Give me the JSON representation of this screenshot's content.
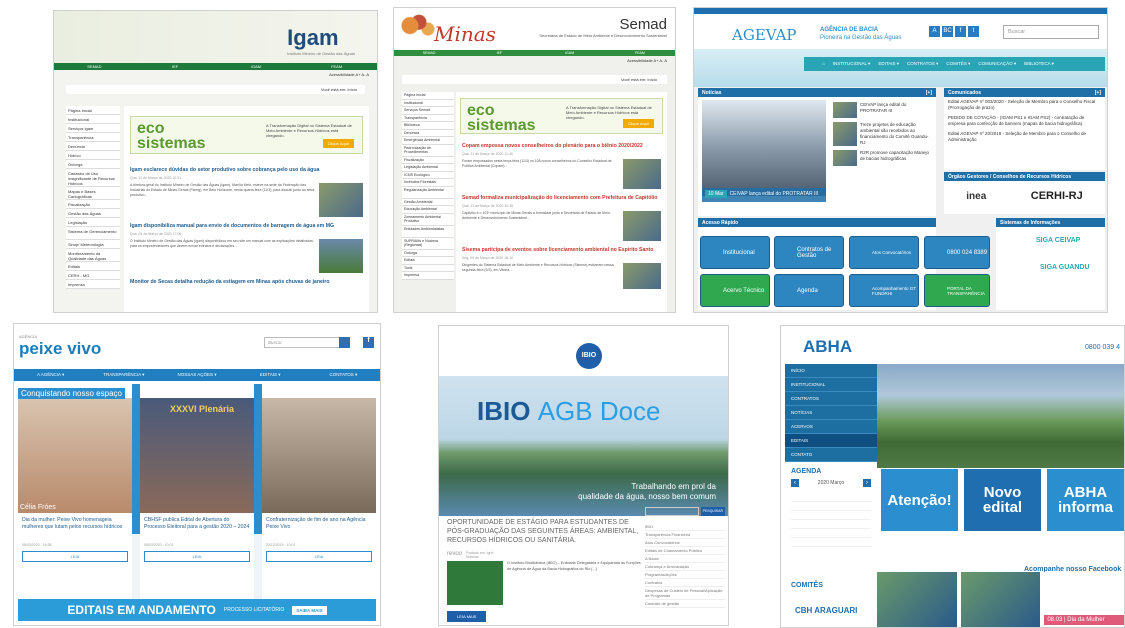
{
  "p1": {
    "logo": "Igam",
    "logo_sub": "Instituto Mineiro de Gestão das Águas",
    "nav": [
      "SEMAD",
      "IEF",
      "IGAM",
      "FEAM"
    ],
    "acc": "Acessibilidade  A+  A-  A",
    "path": "Você está em: Início",
    "side": [
      "Página Inicial",
      "Institucional",
      "Serviços Igam",
      "Transparência",
      "Denúncia",
      "Hídrico",
      "Outorga",
      "Cadastro de Uso Insignificante de Recursos Hídricos",
      "Mapas e Bases Cartográficas",
      "Fiscalização",
      "Gestão das Águas",
      "Legislação",
      "Sistema de Gerenciamento",
      "Sinop/ Meteorologia",
      "Monitoramento da Qualidade das Águas",
      "Editais",
      "CERH - MG",
      "Imprensa"
    ],
    "eco": {
      "w1": "eco",
      "w2": "sistemas",
      "d": "A Transformação Digital no Sistema Estadual de Meio Ambiente e Recursos Hídricos está chegando.",
      "btn": "Clique Aqui!"
    },
    "news": [
      {
        "h": "Igam esclarece dúvidas do setor produtivo sobre cobrança pelo uso da água",
        "d": "Qua, 11 de Março de 2020 10:31",
        "b": "A diretora-geral do Instituto Mineiro de Gestão das Águas (Igam), Marília Melo, esteve na sede da Federação das Indústrias do Estado de Minas Gerais (Fiemg), em Belo Horizonte, nesta quarta-feira (11/3), para discutir junto ao setor produtivo..."
      },
      {
        "h": "Igam disponibiliza manual para envio de documentos de barragem de água em MG",
        "d": "Qua, 04 de Março de 2020 17:06",
        "b": "O Instituto Mineiro de Gestão das Águas (Igam) disponibilizou em seu site um manual com as explicações detalhadas para os empreendedores que devem enviar extratos e declarações..."
      },
      {
        "h": "Monitor de Secas detalha redução da estiagem em Minas após chuvas de janeiro",
        "d": "",
        "b": ""
      }
    ]
  },
  "p2": {
    "minas": "Minas",
    "title": "Semad",
    "sub": "Secretaria de Estado de Meio Ambiente e Desenvolvimento Sustentável",
    "nav": [
      "SEMAD",
      "IEF",
      "IGAM",
      "FEAM"
    ],
    "acc": "Acessibilidade  A+  A-  A",
    "path": "Você está em: Início",
    "side": [
      "Página Inicial",
      "Institucional",
      "Serviços Semad",
      "Transparência",
      "Biblioteca",
      "Denúncia",
      "Emergência Ambiental",
      "Padronização de Procedimentos",
      "Fiscalização",
      "Legislação Ambiental",
      "ICMS Ecológico",
      "Incêndios Florestais",
      "Regularização Ambiental",
      "Gestão Ambiental",
      "Educação Ambiental",
      "Zoneamento Ambiental Produtivo",
      "Entidades Ambientalistas",
      "SUPRAMs e Núcleos (Regionais)",
      "Outorga",
      "Editais",
      "Tools",
      "Imprensa"
    ],
    "eco": {
      "w1": "eco",
      "w2": "sistemas",
      "d": "A Transformação Digital no Sistema Estadual de Meio Ambiente e Recursos Hídricos está chegando.",
      "btn": "Clique Aqui!"
    },
    "news": [
      {
        "h": "Copam empossa novos conselheiros do plenário para o biênio 2020/2022",
        "d": "Qua, 11 de Março de 2020 11:40",
        "b": "Foram empossados nesta terça-feira (11/3) os 108 novos conselheiros do Conselho Estadual de Política Ambiental (Copam)..."
      },
      {
        "h": "Semad formaliza municipalização do licenciamento com Prefeitura de Capitólio",
        "d": "Qua, 11 de Março de 2020 10:36",
        "b": "Capitólio é o 103º município de Minas Gerais a formalizar junto à Secretaria de Estado de Meio Ambiente e Desenvolvimento Sustentável..."
      },
      {
        "h": "Sisema participa de eventos sobre licenciamento ambiental no Espírito Santo",
        "d": "Seg, 09 de Março de 2020 18:10",
        "b": "Dirigentes do Sistema Estadual de Meio Ambiente e Recursos Hídricos (Sisema) estiveram nessa segunda-feira (9/3), em Vitória..."
      }
    ]
  },
  "p3": {
    "logo": "AGEVAP",
    "t1": "AGÊNCIA DE BACIA",
    "t2": "Pioneira na Gestão das Águas",
    "social": [
      "A",
      "BC",
      "f",
      "t"
    ],
    "search": "Buscar",
    "nav": [
      "INSTITUCIONAL ▾",
      "EDITAIS ▾",
      "CONTRATOS ▾",
      "COMITÊS ▾",
      "COMUNICAÇÃO ▾",
      "BIBLIOTECA ▾"
    ],
    "noticias": {
      "h": "Notícias",
      "plus": "[+]",
      "items": [
        "CEIVAP lança edital do PROTRATAR III",
        "Treze projetos de educação ambiental são recebidos ao financiamento do Comitê Guandu-RJ",
        "R2R promove capacitação Manejo de bacias hidrográficas"
      ],
      "date": "10 Mar",
      "cap": "CEIVAP lança edital do PROTRATAR III"
    },
    "comunicados": {
      "h": "Comunicados",
      "plus": "[+]",
      "items": [
        "Edital AGEVAP nº 003/2020 - Seleção de Membro para o Conselho Fiscal (Prorrogação de prazo)",
        "PEDIDO DE COTAÇÃO - (IGAM PS1 e IGAM PS2) - contratação de empresa para confecção de banners (mapas de bacia hidrográfica).",
        "Edital AGEVAP nº 20/2019 - Seleção de Membro para o Conselho de Administração"
      ]
    },
    "orgaos": {
      "h": "Órgãos Gestores / Conselhos de Recursos Hídricos",
      "a": "inea",
      "b": "CERHI-RJ"
    },
    "acesso": {
      "h": "Acesso Rápido",
      "btns": [
        "Institucional",
        "Contratos de Gestão",
        "Atos Convocatórios",
        "0800 024 8389",
        "Acervo Técnico",
        "Agenda",
        "Acompanhamento GT FUNDRHI",
        "PORTAL DA TRANSPARÊNCIA"
      ]
    },
    "sistemas": {
      "h": "Sistemas de Informações",
      "a": "SIGA CEIVAP",
      "b": "SIGA GUANDU"
    }
  },
  "p4": {
    "logo": "peixe vivo",
    "logo_sub": "AGÊNCIA",
    "search": "Buscar",
    "fb": "f",
    "nav": [
      "A AGÊNCIA ▾",
      "TRANSPARÊNCIA ▾",
      "NOSSAS AÇÕES ▾",
      "EDITAIS ▾",
      "CONTATOS ▾"
    ],
    "banner": "Conquistando nosso espaço",
    "cards": [
      {
        "cap": "Célia Fróes",
        "t": "Dia da mulher: Peixe Vivo homenageia mulheres que lutam pelos recursos hídricos",
        "d": "08/03/2020 - 16:38",
        "b": "LEIA"
      },
      {
        "cap": "XXXVI Plenária",
        "t": "CBHSF publica Edital de Abertura do Processo Eleitoral para a gestão 2020 – 2024",
        "d": "05/03/2020 - 10:01",
        "b": "LEIA"
      },
      {
        "cap": "",
        "t": "Confraternização de fim de ano na Agência Peixe Vivo",
        "d": "20/12/2019 - 10:01",
        "b": "LEIA"
      }
    ],
    "editais": "EDITAIS EM ANDAMENTO",
    "proc": "PROCESSO LICITATÓRIO",
    "saiba": "SAIBA MAIS"
  },
  "p5": {
    "logo": "IBIO",
    "t1": "IBIO",
    "t2": "AGB Doce",
    "sub1": "Trabalhando em prol da",
    "sub2": "qualidade da água, nosso bem comum",
    "op": "OPORTUNIDADE DE ESTÁGIO PARA ESTUDANTES DE PÓS-GRADUAÇÃO DAS SEGUINTES ÁREAS: AMBIENTAL, RECURSOS HÍDRICOS OU SANITÁRIA.",
    "rev": "revoo",
    "post": "Postado em: Igrol Notícias",
    "body": "O Instituto BioAtlântica (IBIO) – Entidade Delegatária e Equiparada às Funções de Agência de Água da Bacia Hidrográfica do Rio [...]",
    "leia": "LEIA MAIS",
    "pesq": "PESQUISAR",
    "links": [
      "IBIO",
      "Transparência Financeira",
      "Atos Convocatórios",
      "Editais de Chamamento Público",
      "A Bacia",
      "Cobrança e Arrecadação",
      "Programas/Ações",
      "Contratos",
      "Despesas de Custeio de Pessoal/Aplicação de Programas",
      "Contrato de gestão"
    ]
  },
  "p6": {
    "logo": "ABHA",
    "phone": "0800 039 4",
    "menu": [
      "INÍCIO",
      "INSTITUCIONAL",
      "CONTRATOS",
      "NOTÍCIAS",
      "ACERVOS",
      "EDITAIS",
      "CONTATO"
    ],
    "agenda": "AGENDA",
    "month": "2020 Março",
    "tiles": [
      "Atenção!",
      "Novo edital",
      "ABHA informa"
    ],
    "comites": "COMITÊS",
    "arag": "CBH ARAGUARI",
    "fb": "Acompanhe nosso Facebook",
    "last": "08.03 | Dia da Mulher"
  },
  "colors": {
    "igam_green": "#1d7a3a",
    "agevap_blue": "#1e6fa8",
    "peixe_blue": "#1f7fc0",
    "ibio_blue": "#1c5a96",
    "abha_blue": "#1c6fa0"
  }
}
